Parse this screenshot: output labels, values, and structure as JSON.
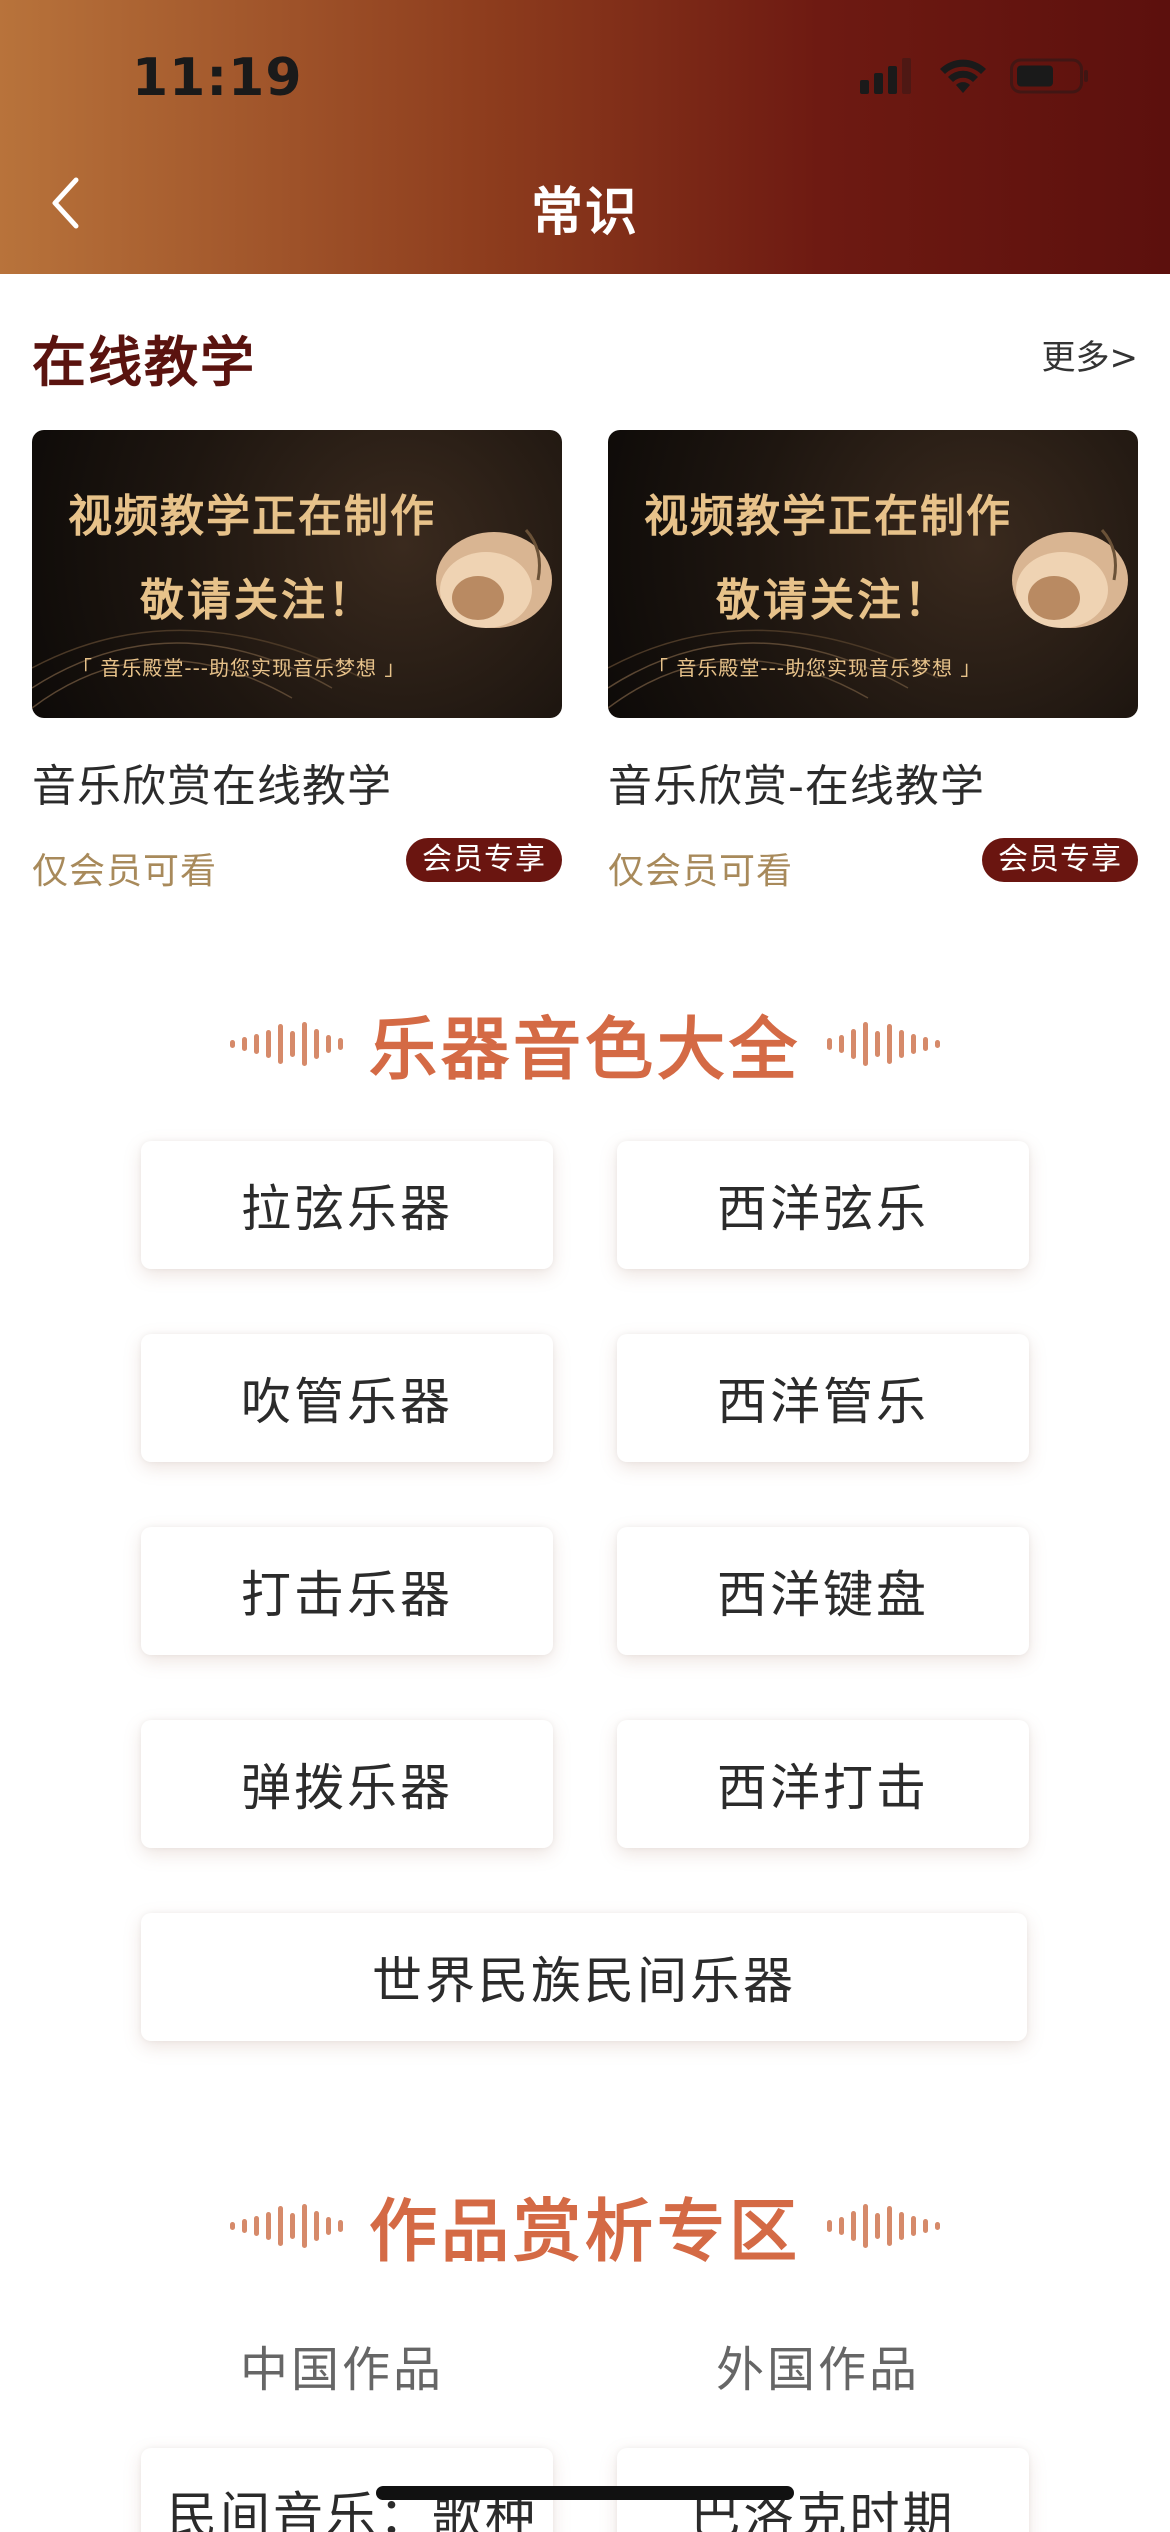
{
  "status_bar": {
    "time": "11:19"
  },
  "nav": {
    "title": "常识"
  },
  "online_teaching": {
    "title": "在线教学",
    "more": "更多>",
    "cards": [
      {
        "thumb_line1": "视频教学正在制作",
        "thumb_line2": "敬请关注！",
        "thumb_line3": "「 音乐殿堂---助您实现音乐梦想 」",
        "title": "音乐欣赏在线教学",
        "access": "仅会员可看",
        "badge": "会员专享"
      },
      {
        "thumb_line1": "视频教学正在制作",
        "thumb_line2": "敬请关注！",
        "thumb_line3": "「 音乐殿堂---助您实现音乐梦想 」",
        "title": "音乐欣赏-在线教学",
        "access": "仅会员可看",
        "badge": "会员专享"
      }
    ]
  },
  "instrument_section": {
    "title": "乐器音色大全",
    "buttons": [
      "拉弦乐器",
      "西洋弦乐",
      "吹管乐器",
      "西洋管乐",
      "打击乐器",
      "西洋键盘",
      "弹拨乐器",
      "西洋打击",
      "世界民族民间乐器"
    ]
  },
  "works_section": {
    "title": "作品赏析专区",
    "tabs": [
      "中国作品",
      "外国作品"
    ],
    "items": [
      "民间音乐：歌种",
      "巴洛克时期"
    ]
  },
  "colors": {
    "header_start": "#b8733b",
    "header_end": "#5c100d",
    "accent_heading": "#d46a45",
    "badge_bg": "#6a1510",
    "section_title": "#5a130f"
  }
}
